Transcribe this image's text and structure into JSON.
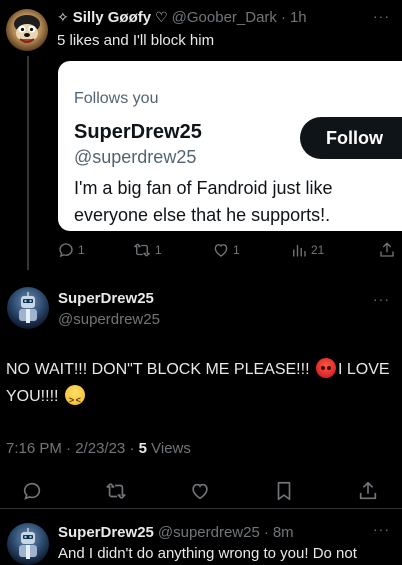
{
  "top_tweet": {
    "name_prefix": "✧",
    "display_name": "Silly Gøøfy",
    "name_suffix": "♡",
    "handle": "@Goober_Dark",
    "separator": "·",
    "time": "1h",
    "more": "···",
    "text": "5 likes and I'll block him",
    "card": {
      "follows_you": "Follows you",
      "name": "SuperDrew25",
      "handle": "@superdrew25",
      "bio": "I'm a big fan of Fandroid just like everyone else that he supports!.",
      "follow_label": "Follow"
    },
    "actions": {
      "replies": "1",
      "retweets": "1",
      "likes": "1",
      "views": "21"
    }
  },
  "main_tweet": {
    "display_name": "SuperDrew25",
    "handle": "@superdrew25",
    "more": "···",
    "text_part1": "NO WAIT!!! DON\"T BLOCK ME PLEASE!!! ",
    "emoji1": "pouting-face",
    "text_part2": "I LOVE YOU!!!! ",
    "emoji2": "confounded-face",
    "time": "7:16 PM",
    "date": "2/23/23",
    "separator": "·",
    "views_count": "5",
    "views_label": "Views"
  },
  "reply_tweet": {
    "display_name": "SuperDrew25",
    "handle": "@superdrew25",
    "separator": "·",
    "time": "8m",
    "more": "···",
    "text": "And I didn't do anything wrong to you! Do not"
  },
  "colors": {
    "background": "#000000",
    "text": "#e7e9ea",
    "muted": "#71767b",
    "divider": "#2f3336"
  }
}
